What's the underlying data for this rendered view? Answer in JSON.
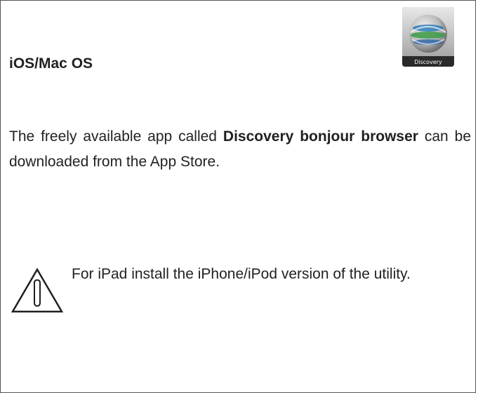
{
  "section": {
    "heading": "iOS/Mac OS",
    "app_icon": {
      "name": "discovery-app-icon",
      "label": "Discovery"
    }
  },
  "body": {
    "text_before": "The freely available app called ",
    "app_name": "Discovery bonjour browser",
    "text_after": " can be downloaded from the App Store."
  },
  "note": {
    "icon": "warning-icon",
    "text": "For iPad install the iPhone/iPod version of the utility."
  },
  "colors": {
    "text": "#231f20",
    "border": "#555555"
  }
}
